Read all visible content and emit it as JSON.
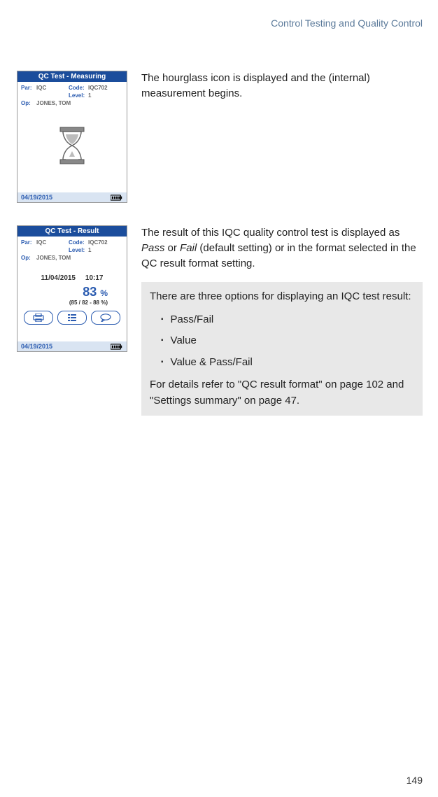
{
  "header": {
    "section_title": "Control Testing and Quality Control"
  },
  "page_number": "149",
  "screen_measuring": {
    "title": "QC Test - Measuring",
    "par_label": "Par:",
    "par_value": "IQC",
    "code_label": "Code:",
    "code_value": "IQC702",
    "level_label": "Level:",
    "level_value": "1",
    "op_label": "Op:",
    "op_value": "JONES, TOM",
    "footer_date": "04/19/2015"
  },
  "screen_result": {
    "title": "QC Test - Result",
    "par_label": "Par:",
    "par_value": "IQC",
    "code_label": "Code:",
    "code_value": "IQC702",
    "level_label": "Level:",
    "level_value": "1",
    "op_label": "Op:",
    "op_value": "JONES, TOM",
    "result_date": "11/04/2015",
    "result_time": "10:17",
    "result_value": "83",
    "result_unit": "%",
    "result_range": "(85 / 82 - 88 %)",
    "footer_date": "04/19/2015"
  },
  "explanation_measuring": "The hourglass icon is displayed and the (internal) measurement begins.",
  "explanation_result_p1a": " The result of this IQC quality control test is displayed as ",
  "explanation_result_pass": "Pass",
  "explanation_result_or": " or ",
  "explanation_result_fail": "Fail",
  "explanation_result_p1b": " (default setting) or in the format selected in the QC result format setting.",
  "infobox": {
    "intro": "There are three options for displaying an IQC test result:",
    "opt1": "Pass/Fail",
    "opt2": "Value",
    "opt3": "Value & Pass/Fail",
    "refs": "For details refer to \"QC result format\" on page 102 and \"Settings summary\" on page 47."
  }
}
